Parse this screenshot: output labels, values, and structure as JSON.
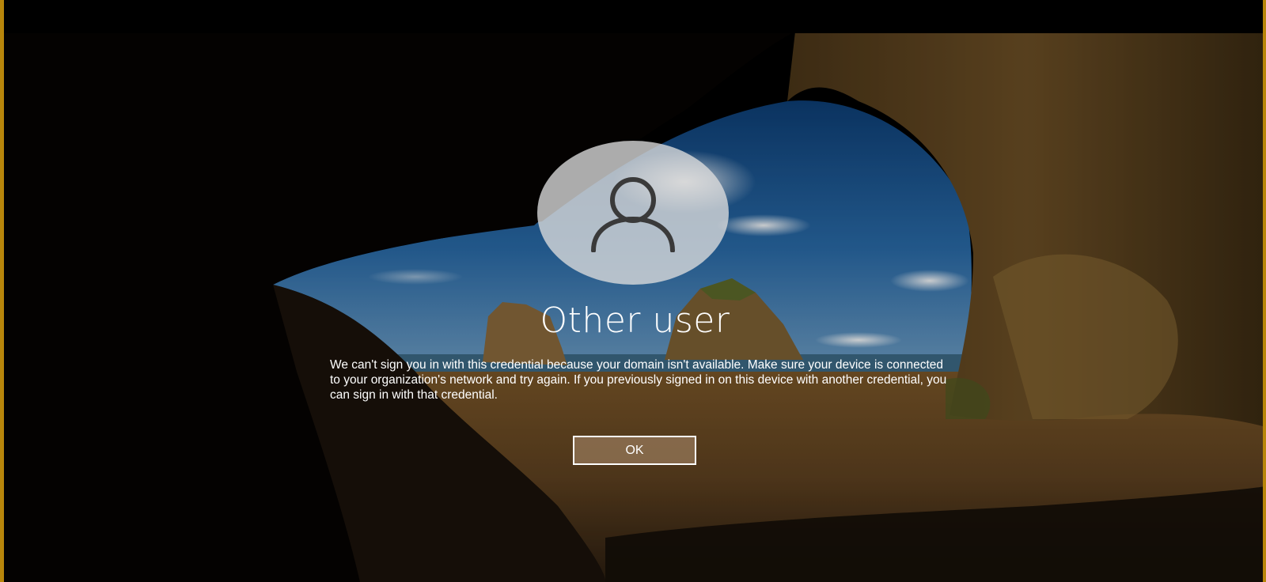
{
  "login": {
    "user_name": "Other user",
    "message": "We can't sign you in with this credential because your domain isn't available. Make sure your device is connected to your organization's network and try again. If you previously signed in on this device with another credential, you can sign in with that credential.",
    "ok_label": "OK",
    "avatar_icon": "user-silhouette-icon"
  },
  "colors": {
    "frame_border": "#b8860b",
    "button_bg": "#967858",
    "text": "#ffffff",
    "avatar_bg": "#dcdcdc"
  }
}
